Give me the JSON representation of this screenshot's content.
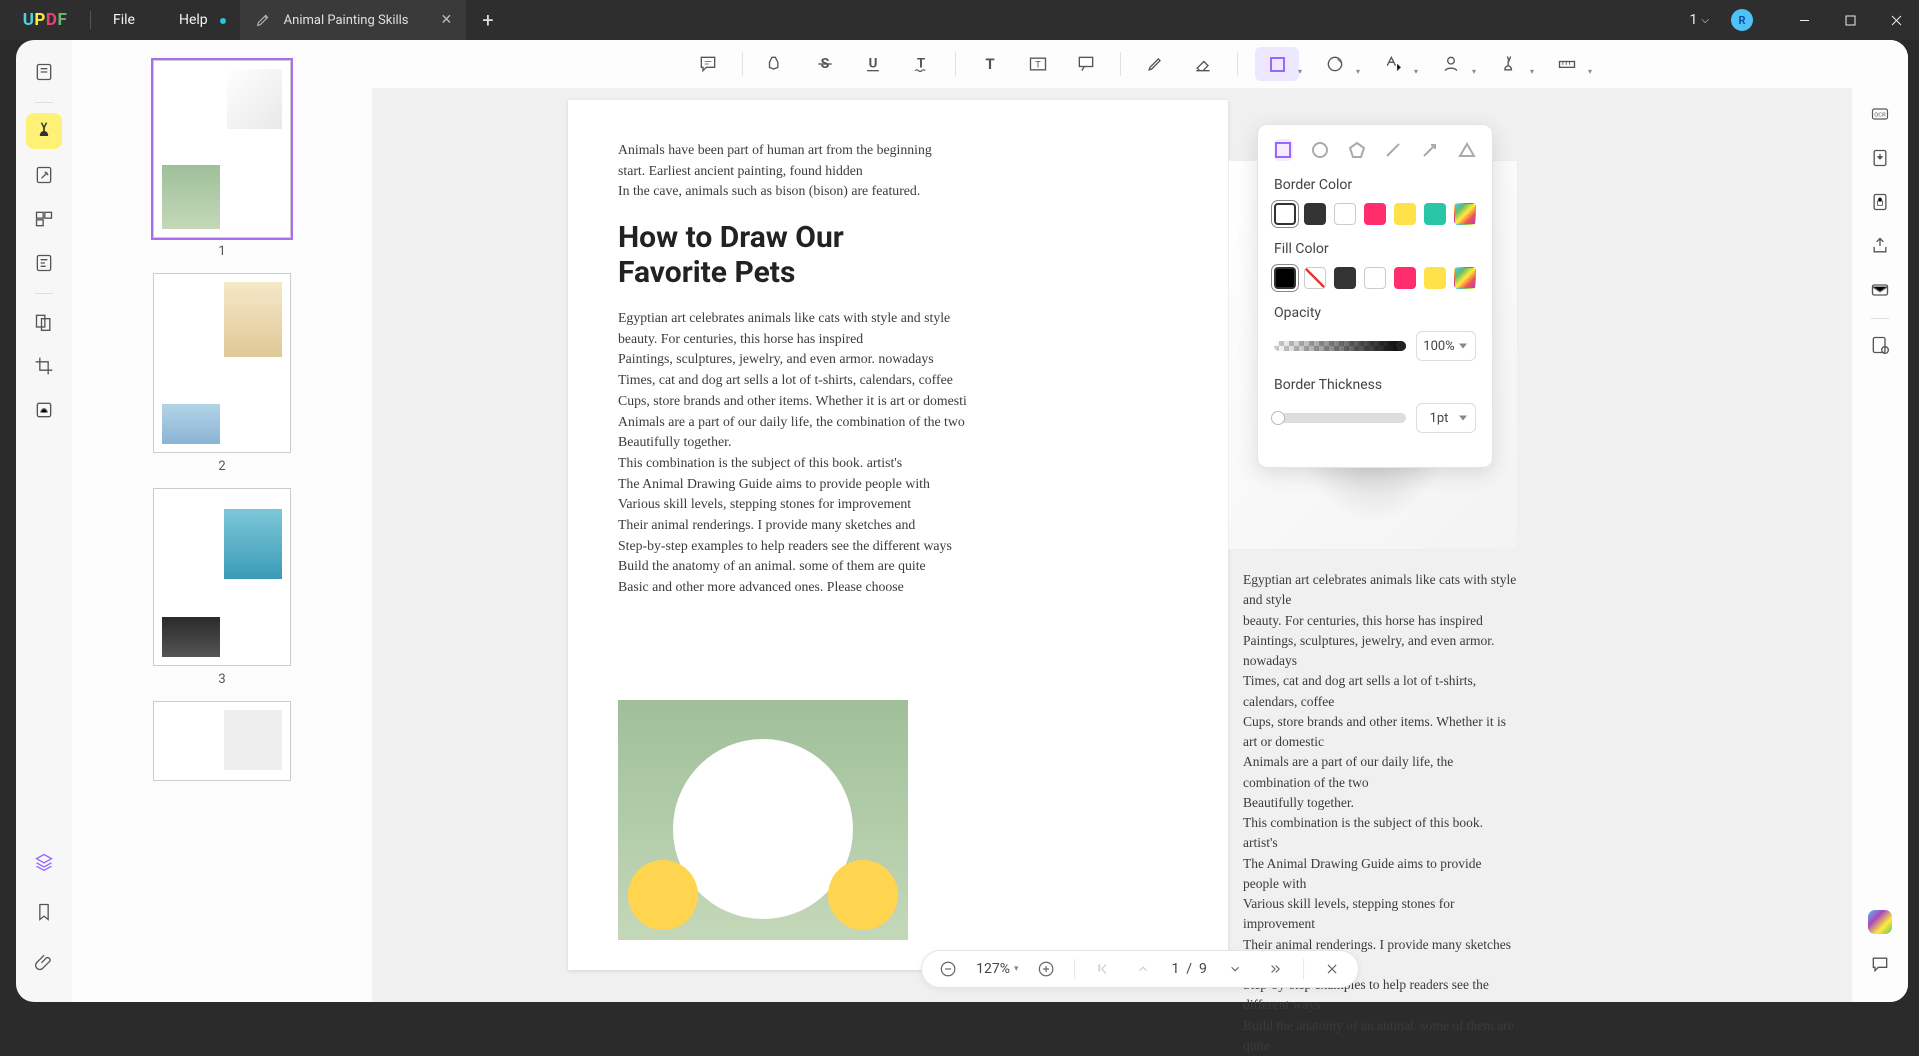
{
  "app": {
    "menu_file": "File",
    "menu_help": "Help",
    "tab_title": "Animal Painting Skills",
    "window_count": "1",
    "avatar_letter": "R"
  },
  "thumbs": {
    "p1": "1",
    "p2": "2",
    "p3": "3"
  },
  "document": {
    "intro": [
      "Animals have been part of human art from the beginning",
      "start. Earliest ancient painting, found hidden",
      "In the cave, animals such as bison (bison) are featured."
    ],
    "title_l1": "How to Draw Our",
    "title_l2": "Favorite Pets",
    "body": [
      "Egyptian art celebrates animals like cats with style and style",
      "beauty. For centuries, this horse has inspired",
      "Paintings, sculptures, jewelry, and even armor. nowadays",
      "Times, cat and dog art sells a lot of t-shirts, calendars, coffee",
      "Cups, store brands and other items. Whether it is art or domesti",
      "Animals are a part of our daily life, the combination of the two",
      "Beautifully together.",
      "This combination is the subject of this book. artist's",
      "The Animal Drawing Guide aims to provide people with",
      "Various skill levels, stepping stones for improvement",
      "Their animal renderings. I provide many sketches and",
      "Step-by-step examples to help readers see the different ways",
      "Build the anatomy of an animal. some of them are quite",
      "Basic and other more advanced ones. Please choose"
    ],
    "right_body": [
      "Egyptian art celebrates animals like cats with style and style",
      "beauty. For centuries, this horse has inspired",
      "Paintings, sculptures, jewelry, and even armor. nowadays",
      "Times, cat and dog art sells a lot of t-shirts, calendars, coffee",
      "Cups, store brands and other items. Whether it is art or domestic",
      "Animals are a part of our daily life, the combination of the two",
      "Beautifully together.",
      "This combination is the subject of this book. artist's",
      "The Animal Drawing Guide aims to provide people with",
      "Various skill levels, stepping stones for improvement",
      "Their animal renderings. I provide many sketches and",
      "Step-by-step examples to help readers see the different ways",
      "Build the anatomy of an animal. some of them are quite"
    ]
  },
  "popup": {
    "border_color_label": "Border Color",
    "fill_color_label": "Fill Color",
    "opacity_label": "Opacity",
    "thickness_label": "Border Thickness",
    "opacity_value": "100%",
    "thickness_value": "1pt",
    "border_colors": [
      "#000000",
      "#333333",
      "#ffffff",
      "#ff2d6b",
      "#ffeb3b",
      "#26c6a6",
      "rainbow"
    ],
    "fill_colors": [
      "#000000",
      "diag",
      "#333333",
      "#ffffff",
      "#ff2d6b",
      "#ffeb3b",
      "rainbow"
    ]
  },
  "bottom": {
    "zoom": "127%",
    "page_current": "1",
    "page_sep": "/",
    "page_total": "9"
  }
}
